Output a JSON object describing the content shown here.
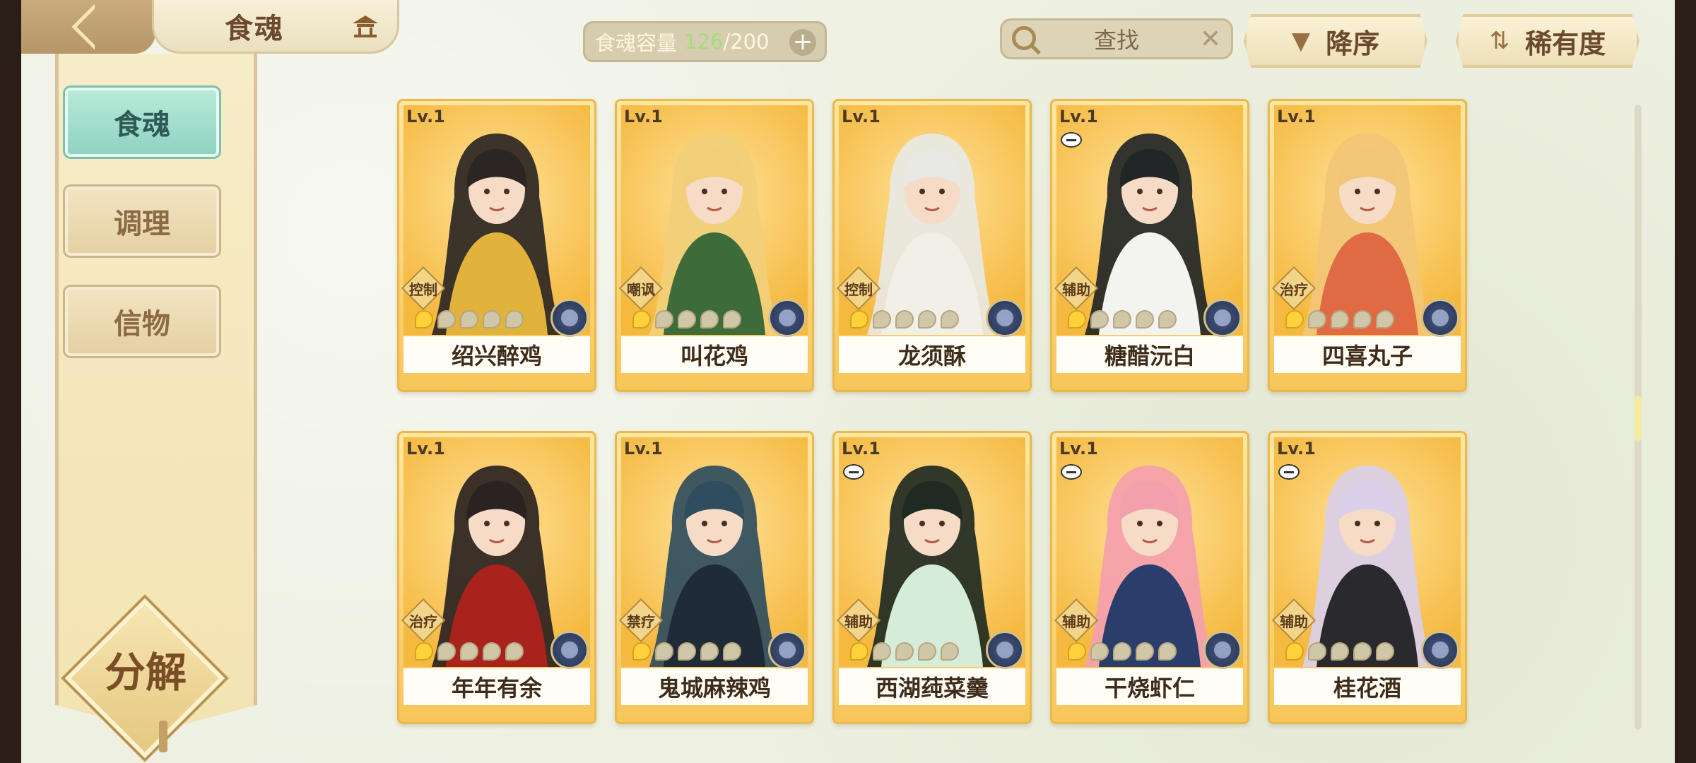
{
  "header": {
    "title": "食魂",
    "back_icon": "back-arrow-icon",
    "home_icon": "pavilion-icon"
  },
  "capacity": {
    "label": "食魂容量",
    "current": "126",
    "max": "/200",
    "plus": "+"
  },
  "search": {
    "text": "查找",
    "clear": "✕"
  },
  "sort": {
    "order_label": "降序",
    "order_icon": "▼",
    "rarity_label": "稀有度",
    "rarity_icon": "⇅"
  },
  "side_tabs": [
    {
      "label": "食魂",
      "active": true
    },
    {
      "label": "调理",
      "active": false
    },
    {
      "label": "信物",
      "active": false
    }
  ],
  "decompose_label": "分解",
  "cards": [
    {
      "level": "Lv.1",
      "role": "控制",
      "name": "绍兴醉鸡",
      "stars": 1,
      "minus": false,
      "hair": "#2b2624",
      "outfit": "#e2b33a"
    },
    {
      "level": "Lv.1",
      "role": "嘲讽",
      "name": "叫花鸡",
      "stars": 1,
      "minus": false,
      "hair": "#f1cf79",
      "outfit": "#3e6b3a"
    },
    {
      "level": "Lv.1",
      "role": "控制",
      "name": "龙须酥",
      "stars": 1,
      "minus": false,
      "hair": "#e8e8e4",
      "outfit": "#f2efe6"
    },
    {
      "level": "Lv.1",
      "role": "辅助",
      "name": "糖醋沅白",
      "stars": 1,
      "minus": true,
      "hair": "#222627",
      "outfit": "#f3f3f0"
    },
    {
      "level": "Lv.1",
      "role": "治疗",
      "name": "四喜丸子",
      "stars": 1,
      "minus": false,
      "hair": "#f2c677",
      "outfit": "#e06a43"
    },
    {
      "level": "Lv.1",
      "role": "治疗",
      "name": "年年有余",
      "stars": 1,
      "minus": false,
      "hair": "#2a2322",
      "outfit": "#a8231c"
    },
    {
      "level": "Lv.1",
      "role": "禁疗",
      "name": "鬼城麻辣鸡",
      "stars": 1,
      "minus": false,
      "hair": "#2f4d5e",
      "outfit": "#1f2c38"
    },
    {
      "level": "Lv.1",
      "role": "辅助",
      "name": "西湖莼菜羹",
      "stars": 1,
      "minus": true,
      "hair": "#1f2a22",
      "outfit": "#d5ecd9"
    },
    {
      "level": "Lv.1",
      "role": "辅助",
      "name": "干烧虾仁",
      "stars": 1,
      "minus": true,
      "hair": "#f4a0ac",
      "outfit": "#2a3d6b"
    },
    {
      "level": "Lv.1",
      "role": "辅助",
      "name": "桂花酒",
      "stars": 1,
      "minus": true,
      "hair": "#d9cfe8",
      "outfit": "#2a2a2e"
    }
  ]
}
